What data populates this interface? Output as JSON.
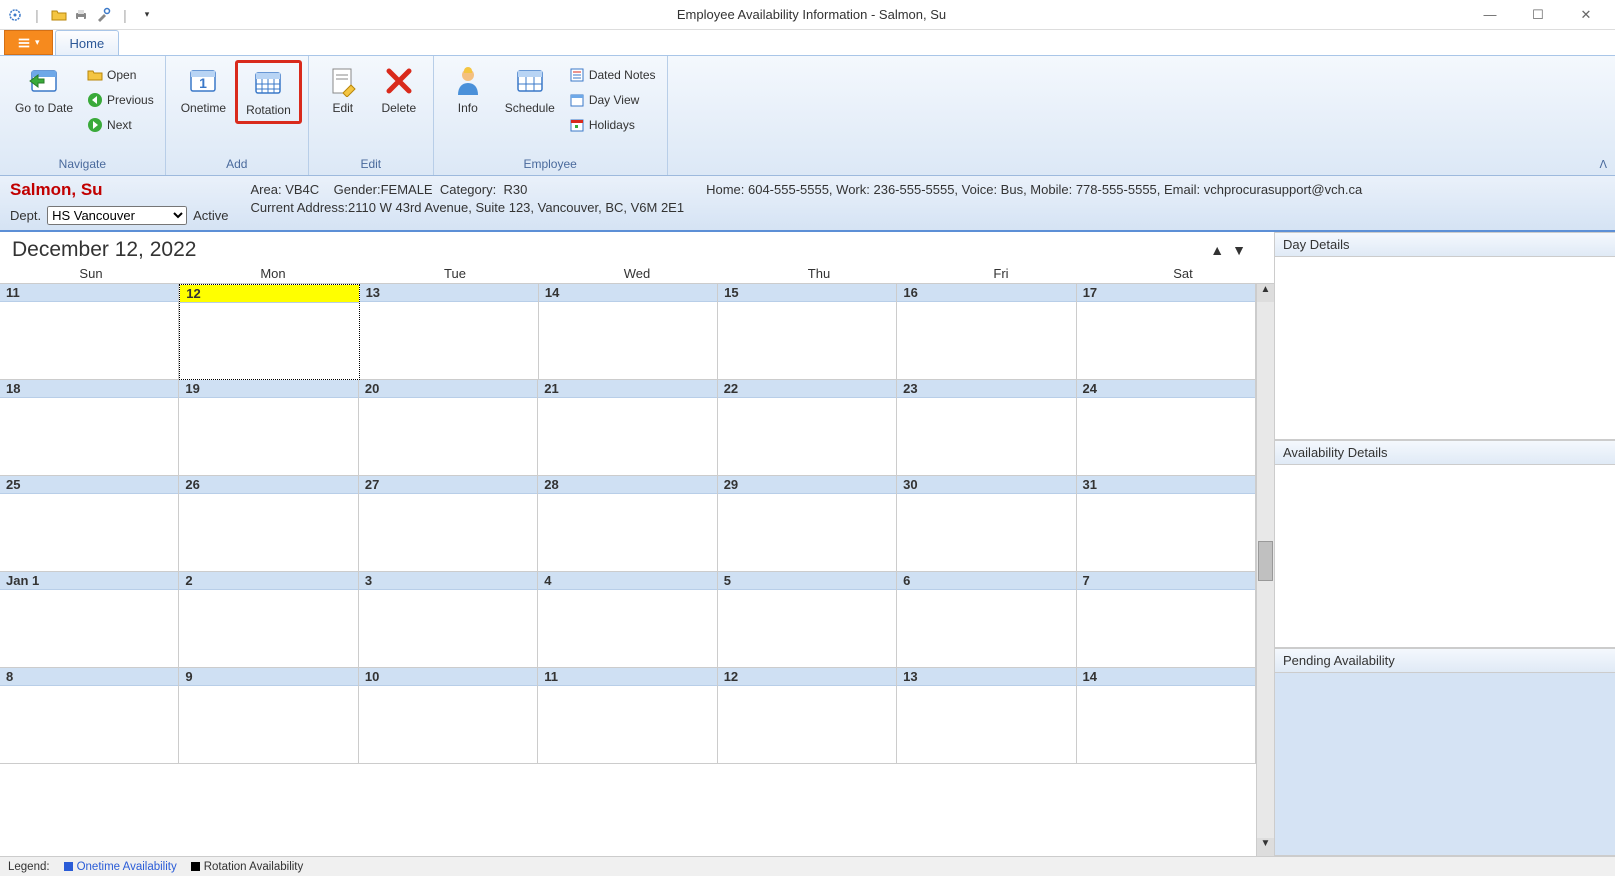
{
  "window": {
    "title": "Employee Availability Information - Salmon, Su"
  },
  "tabs": {
    "home": "Home"
  },
  "ribbon": {
    "navigate": {
      "label": "Navigate",
      "goto": "Go to Date",
      "open": "Open",
      "previous": "Previous",
      "next": "Next"
    },
    "add": {
      "label": "Add",
      "onetime": "Onetime",
      "rotation": "Rotation"
    },
    "edit": {
      "label": "Edit",
      "edit": "Edit",
      "delete": "Delete"
    },
    "employee": {
      "label": "Employee",
      "info": "Info",
      "schedule": "Schedule",
      "dated_notes": "Dated Notes",
      "day_view": "Day View",
      "holidays": "Holidays"
    }
  },
  "infobar": {
    "emp_name": "Salmon, Su",
    "dept_label": "Dept.",
    "dept_value": "HS Vancouver",
    "status": "Active",
    "area_label": "Area:",
    "area_value": "VB4C",
    "gender_label": "Gender:",
    "gender_value": "FEMALE",
    "category_label": "Category:",
    "category_value": "R30",
    "addr_label": "Current Address:",
    "addr_value": "2110 W 43rd Avenue, Suite 123, Vancouver, BC, V6M 2E1",
    "contact": "Home: 604-555-5555, Work: 236-555-5555, Voice: Bus, Mobile: 778-555-5555, Email: vchprocurasupport@vch.ca"
  },
  "calendar": {
    "current_date": "December 12, 2022",
    "days": [
      "Sun",
      "Mon",
      "Tue",
      "Wed",
      "Thu",
      "Fri",
      "Sat"
    ],
    "weeks": [
      [
        "11",
        "12",
        "13",
        "14",
        "15",
        "16",
        "17"
      ],
      [
        "18",
        "19",
        "20",
        "21",
        "22",
        "23",
        "24"
      ],
      [
        "25",
        "26",
        "27",
        "28",
        "29",
        "30",
        "31"
      ],
      [
        "Jan 1",
        "2",
        "3",
        "4",
        "5",
        "6",
        "7"
      ],
      [
        "8",
        "9",
        "10",
        "11",
        "12",
        "13",
        "14"
      ]
    ],
    "selected": {
      "week": 0,
      "day": 1
    }
  },
  "sidepanels": {
    "day_details": "Day Details",
    "availability_details": "Availability Details",
    "pending_availability": "Pending Availability"
  },
  "legend": {
    "label": "Legend:",
    "onetime": "Onetime Availability",
    "rotation": "Rotation Availability"
  }
}
